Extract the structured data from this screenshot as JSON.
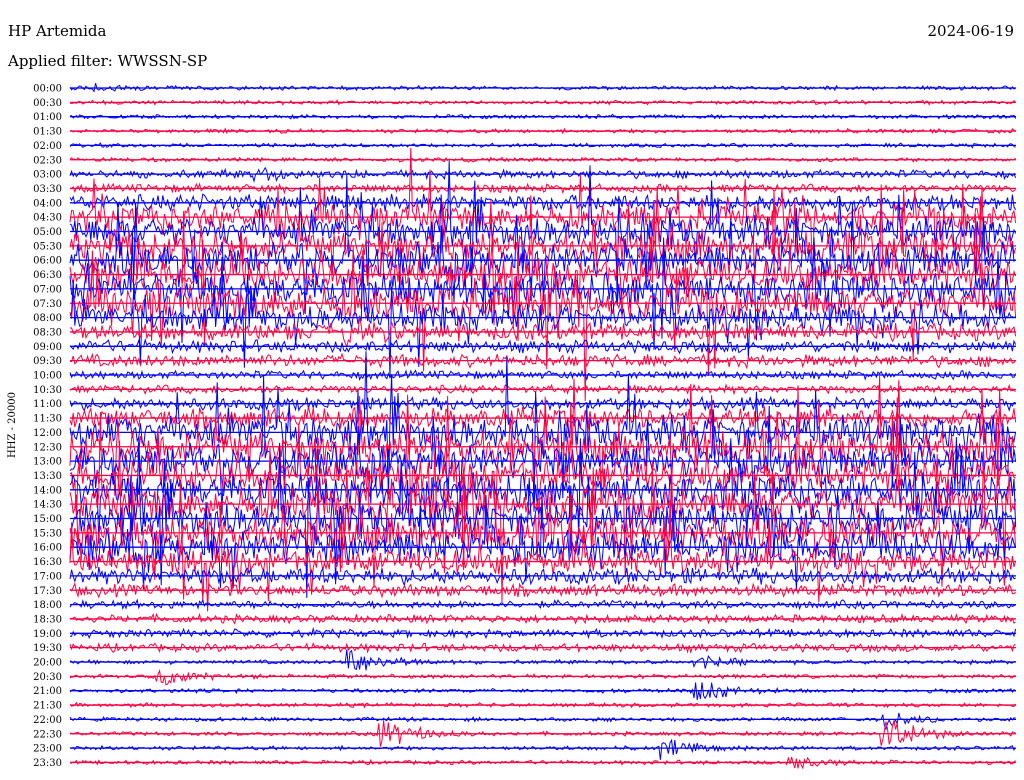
{
  "header": {
    "station": "HP Artemida",
    "filter_label": "Applied filter: WWSSN-SP",
    "date": "2024-06-19"
  },
  "chart_data": {
    "type": "line",
    "ylabel": "HHZ - 20000",
    "row_labels": [
      "00:00",
      "00:30",
      "01:00",
      "01:30",
      "02:00",
      "02:30",
      "03:00",
      "03:30",
      "04:00",
      "04:30",
      "05:00",
      "05:30",
      "06:00",
      "06:30",
      "07:00",
      "07:30",
      "08:00",
      "08:30",
      "09:00",
      "09:30",
      "10:00",
      "10:30",
      "11:00",
      "11:30",
      "12:00",
      "12:30",
      "13:00",
      "13:30",
      "14:00",
      "14:30",
      "15:00",
      "15:30",
      "16:00",
      "16:30",
      "17:00",
      "17:30",
      "18:00",
      "18:30",
      "19:00",
      "19:30",
      "20:00",
      "20:30",
      "21:00",
      "21:30",
      "22:00",
      "22:30",
      "23:00",
      "23:30"
    ],
    "colors": {
      "even_rows": "#0000ff",
      "odd_rows": "#ff0040"
    },
    "activity_level": [
      1,
      1,
      1,
      1,
      1,
      1,
      2,
      2,
      4,
      6,
      7,
      7,
      8,
      8,
      8,
      8,
      6,
      4,
      3,
      3,
      2,
      2,
      3,
      5,
      8,
      8,
      8,
      8,
      8,
      8,
      8,
      8,
      8,
      6,
      4,
      3,
      2,
      2,
      2,
      2,
      1,
      1,
      1,
      1,
      1,
      1,
      1,
      1
    ],
    "events": [
      {
        "row": 0,
        "minute": 1,
        "amplitude": 3
      },
      {
        "row": 6,
        "minute": 6,
        "amplitude": 6
      },
      {
        "row": 17,
        "minute": 9,
        "amplitude": 7
      },
      {
        "row": 40,
        "minute": 9,
        "amplitude": 16
      },
      {
        "row": 40,
        "minute": 20,
        "amplitude": 6
      },
      {
        "row": 41,
        "minute": 3,
        "amplitude": 8
      },
      {
        "row": 42,
        "minute": 20,
        "amplitude": 12
      },
      {
        "row": 44,
        "minute": 26,
        "amplitude": 9
      },
      {
        "row": 45,
        "minute": 10,
        "amplitude": 16
      },
      {
        "row": 45,
        "minute": 26,
        "amplitude": 18
      },
      {
        "row": 46,
        "minute": 19,
        "amplitude": 9
      },
      {
        "row": 47,
        "minute": 23,
        "amplitude": 6
      }
    ]
  }
}
